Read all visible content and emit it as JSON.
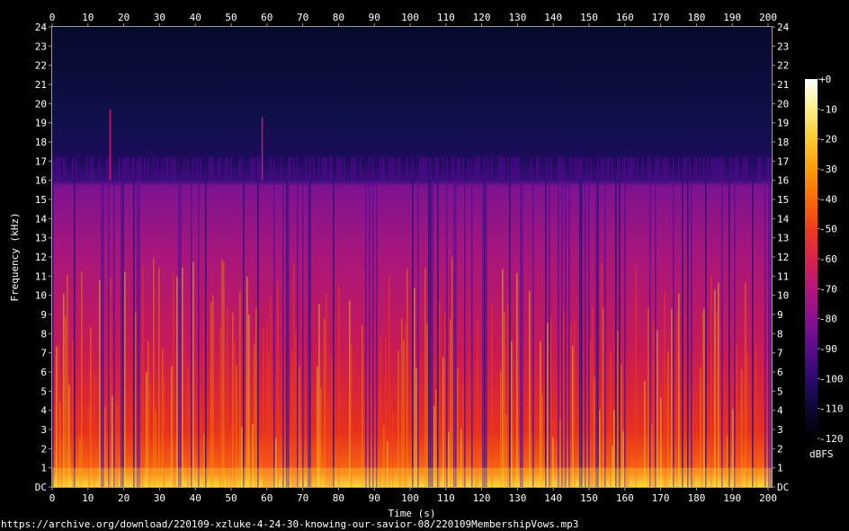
{
  "chart_data": {
    "type": "heatmap",
    "subtype": "spectrogram",
    "xlabel": "Time (s)",
    "ylabel": "Frequency (kHz)",
    "xlim": [
      0,
      201
    ],
    "ylim": [
      0,
      24
    ],
    "x_ticks": [
      "0",
      "10",
      "20",
      "30",
      "40",
      "50",
      "60",
      "70",
      "80",
      "90",
      "100",
      "110",
      "120",
      "130",
      "140",
      "150",
      "160",
      "170",
      "180",
      "190",
      "200"
    ],
    "y_ticks": [
      "DC",
      "1",
      "2",
      "3",
      "4",
      "5",
      "6",
      "7",
      "8",
      "9",
      "10",
      "11",
      "12",
      "13",
      "14",
      "15",
      "16",
      "17",
      "18",
      "19",
      "20",
      "21",
      "22",
      "23",
      "24"
    ],
    "lowpass_cutoff_khz": 16,
    "secondary_band_khz": 17.2,
    "spikes": [
      {
        "time_s": 16,
        "top_khz": 19.7
      },
      {
        "time_s": 58.5,
        "top_khz": 19.3
      }
    ],
    "colorbar": {
      "label": "dBFS",
      "range": [
        -120,
        0
      ],
      "ticks": [
        "+0",
        "-10",
        "-20",
        "-30",
        "-40",
        "-50",
        "-60",
        "-70",
        "-80",
        "-90",
        "-100",
        "-110",
        "-120"
      ],
      "colors": [
        "#000000",
        "#0c0833",
        "#2c0a6e",
        "#5b0c8c",
        "#8a1190",
        "#b5157c",
        "#d9224f",
        "#f03c1e",
        "#fb6b07",
        "#fd9c0c",
        "#fcc92c",
        "#fbef86",
        "#ffffff"
      ]
    }
  },
  "footer": {
    "source_url": "https://archive.org/download/220109-xzluke-4-24-30-knowing-our-savior-08/220109MembershipVows.mp3"
  }
}
